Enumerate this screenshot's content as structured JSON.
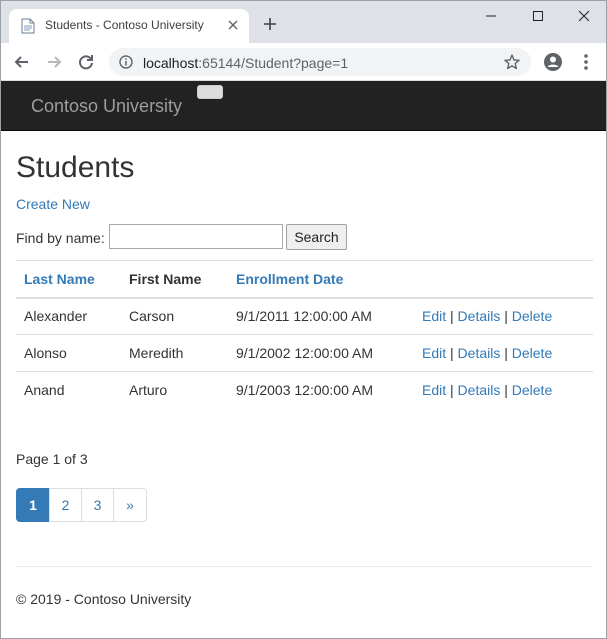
{
  "browser": {
    "tab_title": "Students - Contoso University",
    "url_host": "localhost",
    "url_rest": ":65144/Student?page=1",
    "icons": {
      "favicon": "page-icon",
      "close": "close-icon",
      "new_tab": "plus-icon",
      "back": "arrow-left-icon",
      "forward": "arrow-right-icon",
      "reload": "reload-icon",
      "info": "info-icon",
      "star": "star-icon",
      "account": "account-icon",
      "menu": "kebab-menu-icon"
    }
  },
  "navbar": {
    "brand": "Contoso University",
    "background": "#222222",
    "brand_color": "#9d9d9d"
  },
  "page": {
    "title": "Students",
    "create_new": "Create New",
    "search": {
      "label": "Find by name:",
      "value": "",
      "button": "Search"
    }
  },
  "table": {
    "headers": {
      "last_name": "Last Name",
      "first_name": "First Name",
      "enrollment_date": "Enrollment Date"
    },
    "rows": [
      {
        "last_name": "Alexander",
        "first_name": "Carson",
        "enrollment_date": "9/1/2011 12:00:00 AM"
      },
      {
        "last_name": "Alonso",
        "first_name": "Meredith",
        "enrollment_date": "9/1/2002 12:00:00 AM"
      },
      {
        "last_name": "Anand",
        "first_name": "Arturo",
        "enrollment_date": "9/1/2003 12:00:00 AM"
      }
    ],
    "actions": {
      "edit": "Edit",
      "details": "Details",
      "delete": "Delete",
      "separator": "|"
    }
  },
  "pager": {
    "info": "Page 1 of 3",
    "pages": [
      "1",
      "2",
      "3"
    ],
    "next": "»",
    "current_page": 1,
    "accent": "#337ab7"
  },
  "footer": {
    "text": "© 2019 - Contoso University"
  }
}
